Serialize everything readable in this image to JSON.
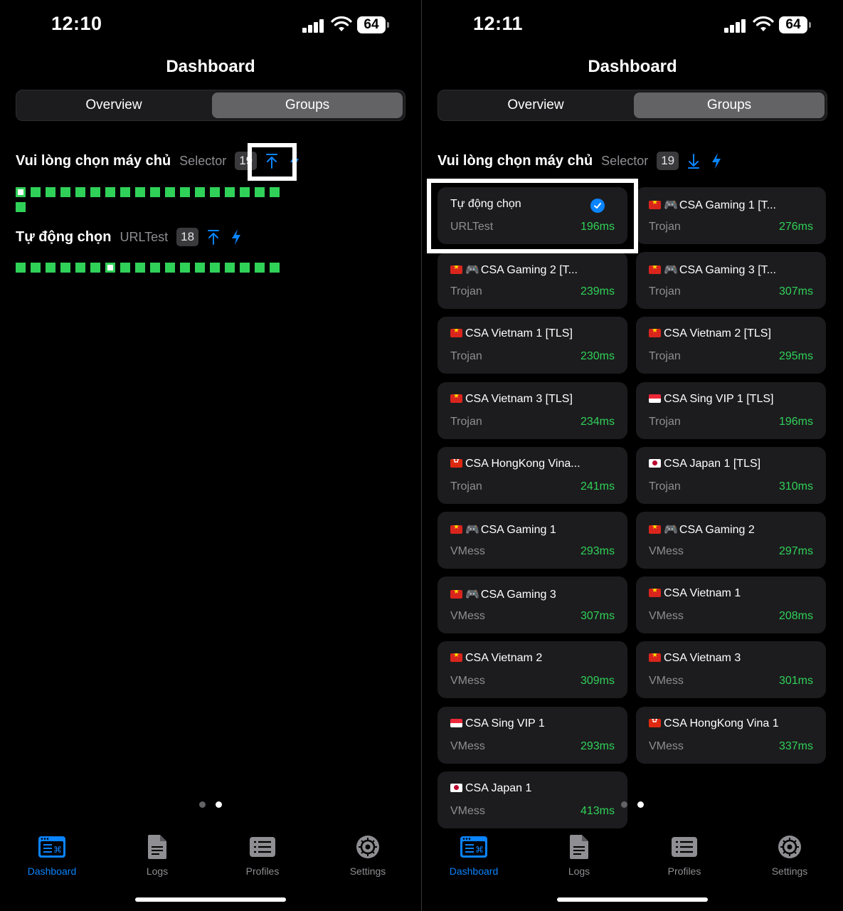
{
  "left": {
    "status": {
      "time": "12:10",
      "battery": "64"
    },
    "title": "Dashboard",
    "segments": {
      "overview": "Overview",
      "groups": "Groups",
      "selected": "Groups"
    },
    "groups": [
      {
        "name": "Vui lòng chọn máy chủ",
        "type": "Selector",
        "count": "19",
        "action_icon": "arrow-up-to-line-icon"
      },
      {
        "name": "Tự động chọn",
        "type": "URLTest",
        "count": "18",
        "action_icon": "arrow-up-to-line-icon"
      }
    ],
    "tabs": [
      "Dashboard",
      "Logs",
      "Profiles",
      "Settings"
    ]
  },
  "right": {
    "status": {
      "time": "12:11",
      "battery": "64"
    },
    "title": "Dashboard",
    "segments": {
      "overview": "Overview",
      "groups": "Groups",
      "selected": "Groups"
    },
    "group": {
      "name": "Vui lòng chọn máy chủ",
      "type": "Selector",
      "count": "19",
      "action_icon": "arrow-down-icon"
    },
    "proxies": [
      {
        "name": "Tự động chọn",
        "type": "URLTest",
        "delay": "196ms",
        "flag": "",
        "gamepad": false,
        "selected": true
      },
      {
        "name": "CSA Gaming 1 [T...",
        "type": "Trojan",
        "delay": "276ms",
        "flag": "vn",
        "gamepad": true
      },
      {
        "name": "CSA Gaming 2 [T...",
        "type": "Trojan",
        "delay": "239ms",
        "flag": "vn",
        "gamepad": true
      },
      {
        "name": "CSA Gaming 3 [T...",
        "type": "Trojan",
        "delay": "307ms",
        "flag": "vn",
        "gamepad": true
      },
      {
        "name": "CSA Vietnam 1 [TLS]",
        "type": "Trojan",
        "delay": "230ms",
        "flag": "vn",
        "gamepad": false
      },
      {
        "name": "CSA Vietnam 2 [TLS]",
        "type": "Trojan",
        "delay": "295ms",
        "flag": "vn",
        "gamepad": false
      },
      {
        "name": "CSA Vietnam 3 [TLS]",
        "type": "Trojan",
        "delay": "234ms",
        "flag": "vn",
        "gamepad": false
      },
      {
        "name": "CSA Sing VIP 1 [TLS]",
        "type": "Trojan",
        "delay": "196ms",
        "flag": "sg",
        "gamepad": false
      },
      {
        "name": "CSA HongKong Vina...",
        "type": "Trojan",
        "delay": "241ms",
        "flag": "hk",
        "gamepad": false
      },
      {
        "name": "CSA Japan 1 [TLS]",
        "type": "Trojan",
        "delay": "310ms",
        "flag": "jp",
        "gamepad": false
      },
      {
        "name": "CSA Gaming 1",
        "type": "VMess",
        "delay": "293ms",
        "flag": "vn",
        "gamepad": true
      },
      {
        "name": "CSA Gaming 2",
        "type": "VMess",
        "delay": "297ms",
        "flag": "vn",
        "gamepad": true
      },
      {
        "name": "CSA Gaming 3",
        "type": "VMess",
        "delay": "307ms",
        "flag": "vn",
        "gamepad": true
      },
      {
        "name": "CSA Vietnam 1",
        "type": "VMess",
        "delay": "208ms",
        "flag": "vn",
        "gamepad": false
      },
      {
        "name": "CSA Vietnam 2",
        "type": "VMess",
        "delay": "309ms",
        "flag": "vn",
        "gamepad": false
      },
      {
        "name": "CSA Vietnam 3",
        "type": "VMess",
        "delay": "301ms",
        "flag": "vn",
        "gamepad": false
      },
      {
        "name": "CSA Sing VIP 1",
        "type": "VMess",
        "delay": "293ms",
        "flag": "sg",
        "gamepad": false
      },
      {
        "name": "CSA HongKong Vina 1",
        "type": "VMess",
        "delay": "337ms",
        "flag": "hk",
        "gamepad": false
      },
      {
        "name": "CSA Japan 1",
        "type": "VMess",
        "delay": "413ms",
        "flag": "jp",
        "gamepad": false
      }
    ],
    "tabs": [
      "Dashboard",
      "Logs",
      "Profiles",
      "Settings"
    ]
  },
  "colors": {
    "accent": "#0a84ff",
    "latency_good": "#30d158",
    "card": "#1c1c1e",
    "background": "#000000"
  }
}
